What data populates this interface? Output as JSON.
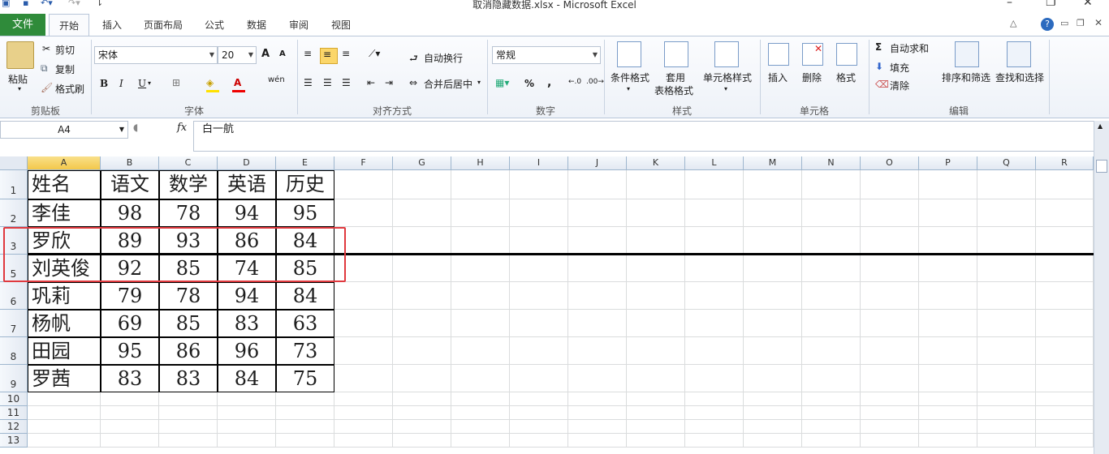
{
  "window": {
    "title": "取消隐藏数据.xlsx  -  Microsoft Excel"
  },
  "tabs": {
    "file": "文件",
    "items": [
      "开始",
      "插入",
      "页面布局",
      "公式",
      "数据",
      "审阅",
      "视图"
    ]
  },
  "ribbon": {
    "clipboard": {
      "paste": "粘贴",
      "cut": "剪切",
      "copy": "复制",
      "format_painter": "格式刷",
      "label": "剪贴板"
    },
    "font": {
      "name": "宋体",
      "size": "20",
      "label": "字体",
      "bold": "B",
      "italic": "I",
      "underline": "U",
      "grow": "A",
      "shrink": "A",
      "phonetic": "wén"
    },
    "alignment": {
      "wrap": "自动换行",
      "merge": "合并后居中",
      "label": "对齐方式"
    },
    "number": {
      "format": "常规",
      "percent": "%",
      "comma": ",",
      "label": "数字"
    },
    "styles": {
      "conditional": "条件格式",
      "table1": "套用",
      "table2": "表格格式",
      "cell_styles": "单元格样式",
      "label": "样式"
    },
    "cells": {
      "insert": "插入",
      "delete": "删除",
      "format": "格式",
      "label": "单元格"
    },
    "editing": {
      "autosum": "自动求和",
      "fill": "填充",
      "clear": "清除",
      "sort": "排序和筛选",
      "find": "查找和选择",
      "label": "编辑"
    }
  },
  "formula_bar": {
    "name_box": "A4",
    "fx": "fx",
    "value": "白一航"
  },
  "columns": [
    "A",
    "B",
    "C",
    "D",
    "E",
    "F",
    "G",
    "H",
    "I",
    "J",
    "K",
    "L",
    "M",
    "N",
    "O",
    "P",
    "Q",
    "R"
  ],
  "selected_column": "A",
  "rows": [
    {
      "num": "1",
      "cells": [
        "姓名",
        "语文",
        "数学",
        "英语",
        "历史"
      ]
    },
    {
      "num": "2",
      "cells": [
        "李佳",
        "98",
        "78",
        "94",
        "95"
      ]
    },
    {
      "num": "3",
      "cells": [
        "罗欣",
        "89",
        "93",
        "86",
        "84"
      ]
    },
    {
      "num": "5",
      "cells": [
        "刘英俊",
        "92",
        "85",
        "74",
        "85"
      ]
    },
    {
      "num": "6",
      "cells": [
        "巩莉",
        "79",
        "78",
        "94",
        "84"
      ]
    },
    {
      "num": "7",
      "cells": [
        "杨帆",
        "69",
        "85",
        "83",
        "63"
      ]
    },
    {
      "num": "8",
      "cells": [
        "田园",
        "95",
        "86",
        "96",
        "73"
      ]
    },
    {
      "num": "9",
      "cells": [
        "罗茜",
        "83",
        "83",
        "84",
        "75"
      ]
    },
    {
      "num": "10",
      "cells": []
    },
    {
      "num": "11",
      "cells": []
    },
    {
      "num": "12",
      "cells": []
    },
    {
      "num": "13",
      "cells": []
    }
  ],
  "colors": {
    "file_tab": "#2f8b3a",
    "highlight_box": "#e0393e",
    "selected_header": "#f3c84b"
  }
}
